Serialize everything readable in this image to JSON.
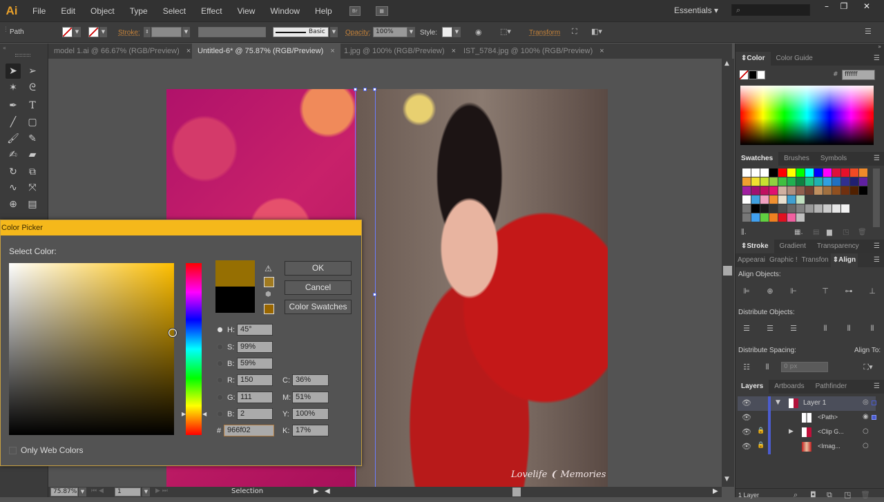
{
  "app": {
    "logo": "Ai",
    "menu": [
      "File",
      "Edit",
      "Object",
      "Type",
      "Select",
      "Effect",
      "View",
      "Window",
      "Help"
    ],
    "bridge_icon": "Br",
    "workspace": "Essentials",
    "search_icon": "⌕",
    "window_buttons": {
      "minimize": "–",
      "restore": "❐",
      "close": "✕"
    }
  },
  "controlbar": {
    "selection_type": "Path",
    "stroke_label": "Stroke:",
    "brush_label": "Basic",
    "opacity_label": "Opacity:",
    "opacity_value": "100%",
    "style_label": "Style:",
    "transform_label": "Transform"
  },
  "tabs": [
    {
      "label": "model 1.ai @ 66.67% (RGB/Preview)",
      "active": false
    },
    {
      "label": "Untitled-6* @ 75.87% (RGB/Preview)",
      "active": true
    },
    {
      "label": "1.jpg @ 100% (RGB/Preview)",
      "active": false
    },
    {
      "label": "IST_5784.jpg @ 100% (RGB/Preview)",
      "active": false
    }
  ],
  "tab_close": "×",
  "canvas": {
    "watermark": "Lovelife ❨ Memories"
  },
  "statusbar": {
    "zoom": "75.87%",
    "artboard": "1",
    "tool": "Selection"
  },
  "color_panel": {
    "tabs": [
      "Color",
      "Color Guide"
    ],
    "hex_value": "ffffff",
    "hex_symbol": "#"
  },
  "swatches_panel": {
    "tabs": [
      "Swatches",
      "Brushes",
      "Symbols"
    ],
    "rows": [
      [
        "#ffffff",
        "#ffffff",
        "#ffffff",
        "#000000",
        "#ff0000",
        "#ffff00",
        "#00ff00",
        "#00ffff",
        "#0000ff",
        "#ff00ff",
        "#e0103a",
        "#e8102a",
        "#f04a24",
        "#f08a2a"
      ],
      [
        "#f0a030",
        "#f0e030",
        "#c8e030",
        "#90d040",
        "#40c040",
        "#20b050",
        "#108040",
        "#20c080",
        "#20b0b0",
        "#30a0e0",
        "#2070c0",
        "#303090",
        "#202070",
        "#6020a0"
      ],
      [
        "#a020a0",
        "#a01070",
        "#c01060",
        "#e01070",
        "#d0b0a0",
        "#b09080",
        "#906050",
        "#704030",
        "#c09060",
        "#a07040",
        "#905020",
        "#703010",
        "#502000",
        "#000000"
      ]
    ],
    "gray_row": [
      "#000000",
      "#1a1a1a",
      "#333333",
      "#4d4d4d",
      "#666666",
      "#808080",
      "#999999",
      "#b3b3b3",
      "#cccccc",
      "#e6e6e6",
      "#f2f2f2"
    ],
    "group_row": [
      "#40a0f0",
      "#60d040",
      "#f08020",
      "#e01020",
      "#f060a0",
      "#c0c0c0"
    ]
  },
  "stroke_panel": {
    "tabs": [
      "Stroke",
      "Gradient",
      "Transparency"
    ]
  },
  "align_panel": {
    "tabs": [
      "Appearai",
      "Graphic !",
      "Transfon",
      "Align"
    ],
    "align_objects": "Align Objects:",
    "distribute_objects": "Distribute Objects:",
    "distribute_spacing": "Distribute Spacing:",
    "align_to": "Align To:",
    "spacing_value": "0 px"
  },
  "layers_panel": {
    "tabs": [
      "Layers",
      "Artboards",
      "Pathfinder"
    ],
    "items": [
      {
        "name": "Layer 1",
        "locked": false,
        "expanded": true
      },
      {
        "name": "<Path>",
        "locked": false
      },
      {
        "name": "<Clip G...",
        "locked": true,
        "collapsed": true
      },
      {
        "name": "<Imag...",
        "locked": true
      }
    ],
    "count": "1 Layer"
  },
  "color_picker": {
    "title": "Color Picker",
    "select_label": "Select Color:",
    "new_color": "#966f02",
    "old_color": "#000000",
    "warning_swatch": "#a07a20",
    "web_swatch": "#996600",
    "buttons": {
      "ok": "OK",
      "cancel": "Cancel",
      "swatches": "Color Swatches"
    },
    "hsb": {
      "H": "45°",
      "S": "99%",
      "B": "59%"
    },
    "rgb": {
      "R": "150",
      "G": "111",
      "B": "2"
    },
    "cmyk": {
      "C": "36%",
      "M": "51%",
      "Y": "100%",
      "K": "17%"
    },
    "hex": "966f02",
    "hex_label": "#",
    "web_only": "Only Web Colors",
    "selected_mode": "H"
  }
}
